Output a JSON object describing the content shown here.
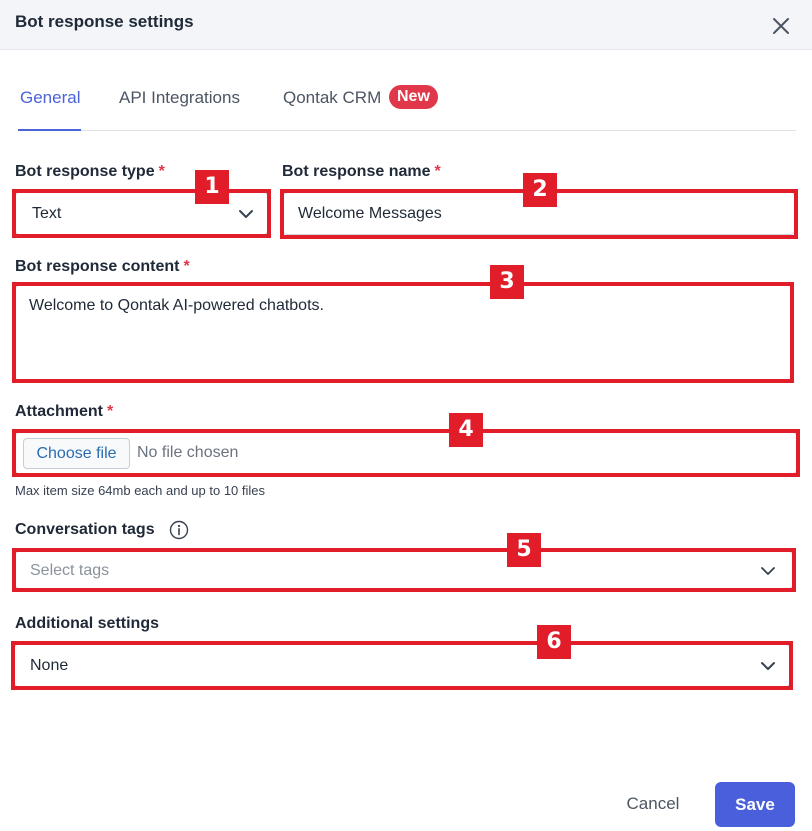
{
  "dialog": {
    "title": "Bot response settings",
    "close_icon": "close-icon"
  },
  "tabs": [
    {
      "label": "General",
      "active": true
    },
    {
      "label": "API Integrations",
      "active": false
    },
    {
      "label": "Qontak CRM",
      "active": false,
      "badge": "New"
    }
  ],
  "form": {
    "required_mark": "*",
    "response_type": {
      "label": "Bot response type",
      "value": "Text"
    },
    "response_name": {
      "label": "Bot response name",
      "value": "Welcome Messages"
    },
    "response_content": {
      "label": "Bot response content",
      "value": "Welcome to Qontak AI-powered chatbots."
    },
    "attachment": {
      "label": "Attachment",
      "button": "Choose file",
      "status": "No file chosen",
      "helper": "Max item size 64mb each and up to 10 files"
    },
    "conversation_tags": {
      "label": "Conversation tags",
      "placeholder": "Select tags"
    },
    "additional_settings": {
      "label": "Additional settings",
      "value": "None"
    }
  },
  "annotations": [
    "1",
    "2",
    "3",
    "4",
    "5",
    "6"
  ],
  "actions": {
    "cancel": "Cancel",
    "save": "Save"
  },
  "colors": {
    "accent": "#4a63d9",
    "badge": "#e0384a",
    "highlight": "#e11d2a",
    "save_button": "#4a5fdb"
  }
}
